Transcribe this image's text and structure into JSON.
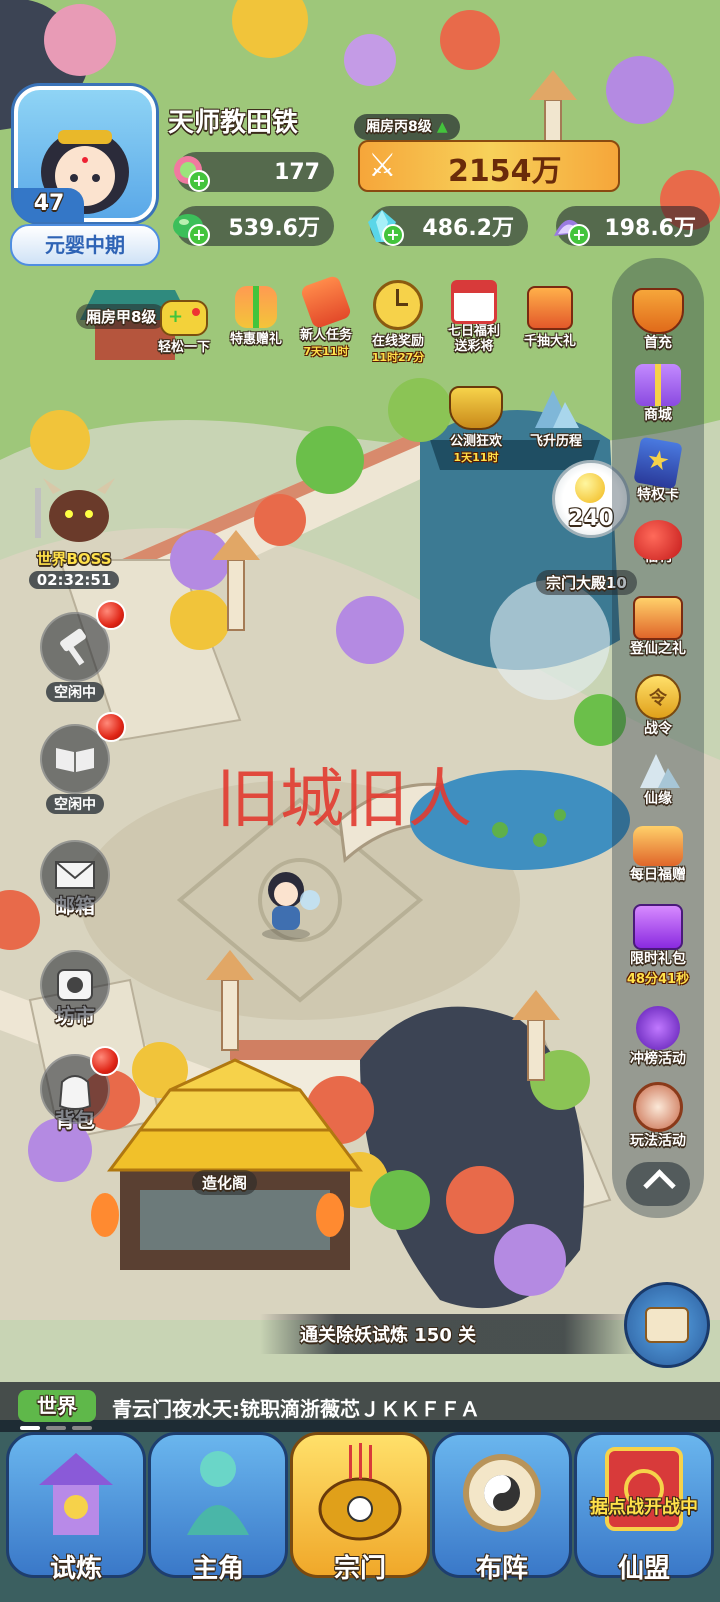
{
  "player": {
    "name": "天师教田铁",
    "level": "47",
    "realm": "元婴中期"
  },
  "power": {
    "building_label": "厢房丙8级",
    "value": "2154万"
  },
  "resources": {
    "gem": "177",
    "jade": "539.6万",
    "crystal": "486.2万",
    "spirit": "198.6万"
  },
  "map_labels": {
    "building_a": "厢房甲8级",
    "sect_hall": "宗门大殿10",
    "sect_hall_level": "240",
    "forge": "造化阁",
    "watermark": "旧城旧人",
    "guide_text": "通关除妖试炼 150 关"
  },
  "top_icons": [
    {
      "label": "轻松一下",
      "timer": "",
      "icon": "gamepad-icon"
    },
    {
      "label": "特惠赠礼",
      "timer": "",
      "icon": "gift-box-icon"
    },
    {
      "label": "新人任务",
      "timer": "7天11时",
      "icon": "scroll-icon"
    },
    {
      "label": "在线奖励",
      "timer": "11时27分",
      "icon": "clock-icon"
    },
    {
      "label": "七日福利\n送彩将",
      "timer": "",
      "icon": "calendar-icon"
    },
    {
      "label": "千抽大礼",
      "timer": "",
      "icon": "treasure-chest-icon"
    }
  ],
  "events_row2": [
    {
      "label": "公测狂欢",
      "timer": "1天11时",
      "icon": "cauldron-icon"
    },
    {
      "label": "飞升历程",
      "timer": "",
      "icon": "mountain-icon"
    }
  ],
  "right_menu": [
    {
      "label": "首充",
      "timer": "",
      "icon": "crown-badge-icon"
    },
    {
      "label": "商城",
      "timer": "",
      "icon": "shop-gift-icon"
    },
    {
      "label": "特权卡",
      "timer": "",
      "icon": "star-card-icon"
    },
    {
      "label": "福利",
      "timer": "",
      "icon": "red-pouch-icon"
    },
    {
      "label": "登仙之礼",
      "timer": "",
      "icon": "gift-chest-icon"
    },
    {
      "label": "战令",
      "timer": "",
      "icon": "battle-pass-icon"
    },
    {
      "label": "仙缘",
      "timer": "",
      "icon": "peak-icon"
    },
    {
      "label": "每日福赠",
      "timer": "",
      "icon": "daily-gift-icon"
    },
    {
      "label": "限时礼包",
      "timer": "48分41秒",
      "icon": "purple-box-icon"
    },
    {
      "label": "冲榜活动",
      "timer": "",
      "icon": "dragon-icon"
    },
    {
      "label": "玩法活动",
      "timer": "",
      "icon": "drum-icon"
    }
  ],
  "boss": {
    "label": "世界BOSS",
    "timer": "02:32:51"
  },
  "left_tools": [
    {
      "label": "空闲中",
      "icon": "hammer-icon"
    },
    {
      "label": "空闲中",
      "icon": "book-icon"
    }
  ],
  "left_menu": [
    {
      "label": "邮箱",
      "icon": "mail-icon"
    },
    {
      "label": "坊市",
      "icon": "market-icon"
    },
    {
      "label": "背包",
      "icon": "bag-icon"
    }
  ],
  "chat": {
    "channel": "世界",
    "message": "青云门夜水天:铳职滴浙薇芯ＪＫＫＦＦＡ"
  },
  "bottom_nav": [
    {
      "label": "试炼",
      "badge": "",
      "icon": "pagoda-icon"
    },
    {
      "label": "主角",
      "badge": "",
      "icon": "meditating-statue-icon"
    },
    {
      "label": "宗门",
      "badge": "",
      "icon": "incense-burner-icon"
    },
    {
      "label": "布阵",
      "badge": "",
      "icon": "yin-yang-icon"
    },
    {
      "label": "仙盟",
      "badge": "据点战开战中",
      "icon": "banner-icon"
    }
  ],
  "colors": {
    "accent_gold": "#f5c12e",
    "plus_green": "#43c43c",
    "realm_blue": "#4f8ee0",
    "red_dot": "#e02617"
  }
}
